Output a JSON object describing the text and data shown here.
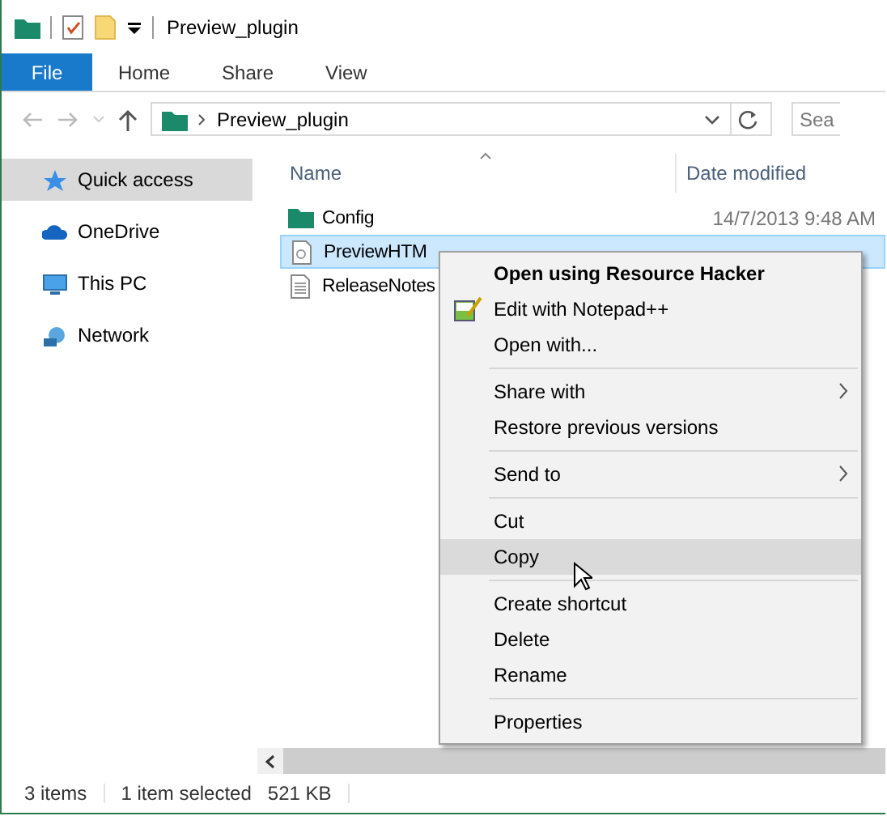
{
  "window": {
    "title": "Preview_plugin"
  },
  "ribbon_tabs": [
    {
      "label": "File",
      "kind": "file",
      "selected": false
    },
    {
      "label": "Home",
      "kind": "tab",
      "selected": false
    },
    {
      "label": "Share",
      "kind": "tab",
      "selected": false
    },
    {
      "label": "View",
      "kind": "tab",
      "selected": false
    }
  ],
  "address_bar": {
    "path": "Preview_plugin"
  },
  "search": {
    "placeholder": "Sea"
  },
  "sidebar": {
    "items": [
      {
        "label": "Quick access",
        "kind": "quick",
        "selected": true
      },
      {
        "label": "OneDrive",
        "kind": "cloud",
        "selected": false
      },
      {
        "label": "This PC",
        "kind": "pc",
        "selected": false
      },
      {
        "label": "Network",
        "kind": "network",
        "selected": false
      }
    ]
  },
  "table": {
    "columns": [
      "Name",
      "Date modified"
    ],
    "rows": [
      {
        "name": "Config",
        "kind": "folder",
        "date": "14/7/2013 9:48 AM",
        "selected": false
      },
      {
        "name": "PreviewHTM",
        "kind": "plugin",
        "selected": true
      },
      {
        "name": "ReleaseNotes",
        "kind": "text",
        "selected": false
      }
    ]
  },
  "context_menu": {
    "items": [
      {
        "kind": "item",
        "label": "Open using Resource Hacker",
        "default": true,
        "icon": false,
        "submenu": false,
        "selected": false
      },
      {
        "kind": "item",
        "label": "Edit with Notepad++",
        "default": false,
        "icon": true,
        "submenu": false,
        "selected": false
      },
      {
        "kind": "item",
        "label": "Open with...",
        "default": false,
        "icon": false,
        "submenu": false,
        "selected": false
      },
      {
        "kind": "separator"
      },
      {
        "kind": "item",
        "label": "Share with",
        "default": false,
        "icon": false,
        "submenu": true,
        "selected": false
      },
      {
        "kind": "item",
        "label": "Restore previous versions",
        "default": false,
        "icon": false,
        "submenu": false,
        "selected": false
      },
      {
        "kind": "separator"
      },
      {
        "kind": "item",
        "label": "Send to",
        "default": false,
        "icon": false,
        "submenu": true,
        "selected": false
      },
      {
        "kind": "separator"
      },
      {
        "kind": "item",
        "label": "Cut",
        "default": false,
        "icon": false,
        "submenu": false,
        "selected": false
      },
      {
        "kind": "item",
        "label": "Copy",
        "default": false,
        "icon": false,
        "submenu": false,
        "selected": true
      },
      {
        "kind": "separator"
      },
      {
        "kind": "item",
        "label": "Create shortcut",
        "default": false,
        "icon": false,
        "submenu": false,
        "selected": false
      },
      {
        "kind": "item",
        "label": "Delete",
        "default": false,
        "icon": false,
        "submenu": false,
        "selected": false
      },
      {
        "kind": "item",
        "label": "Rename",
        "default": false,
        "icon": false,
        "submenu": false,
        "selected": false
      },
      {
        "kind": "separator"
      },
      {
        "kind": "item",
        "label": "Properties",
        "default": false,
        "icon": false,
        "submenu": false,
        "selected": false
      }
    ]
  },
  "status_bar": {
    "items": "3 items",
    "selection": "1 item selected",
    "size": "521 KB"
  }
}
